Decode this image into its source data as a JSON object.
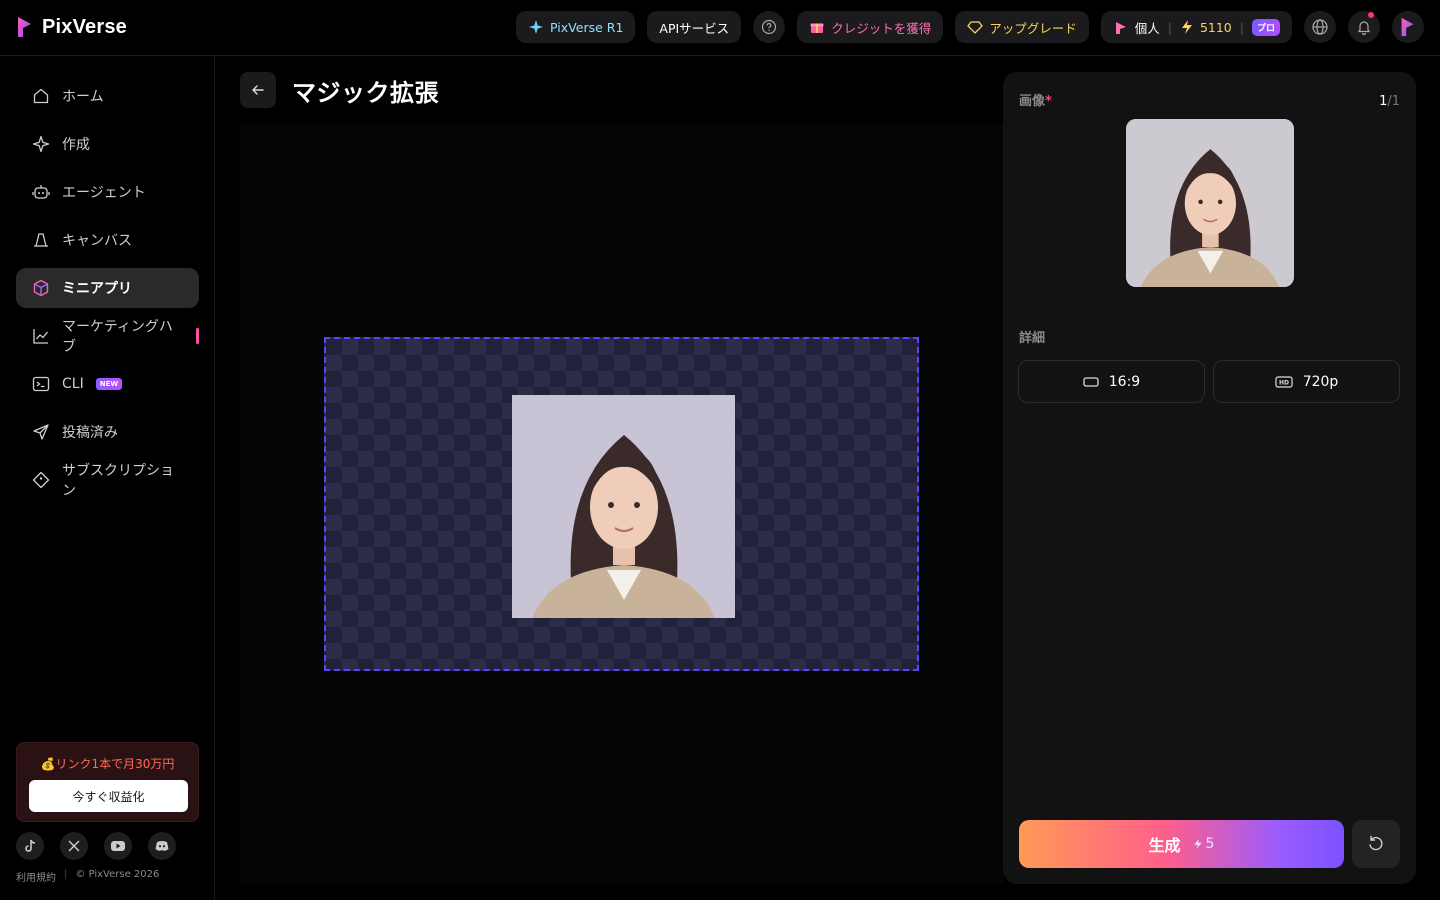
{
  "app": {
    "name": "PixVerse"
  },
  "topbar": {
    "r1_label": "PixVerse R1",
    "api_label": "APIサービス",
    "credits_label": "クレジットを獲得",
    "upgrade_label": "アップグレード",
    "account_label": "個人",
    "credit_count": "5110",
    "plan_label": "プロ"
  },
  "sidebar": {
    "items": [
      {
        "label": "ホーム",
        "icon": "home-icon"
      },
      {
        "label": "作成",
        "icon": "sparkle-icon"
      },
      {
        "label": "エージェント",
        "icon": "robot-icon"
      },
      {
        "label": "キャンバス",
        "icon": "canvas-icon"
      },
      {
        "label": "ミニアプリ",
        "icon": "cube-icon",
        "active": true
      },
      {
        "label": "マーケティングハブ",
        "icon": "chart-icon"
      },
      {
        "label": "CLI",
        "icon": "terminal-icon",
        "badge": "NEW"
      },
      {
        "label": "投稿済み",
        "icon": "send-icon"
      },
      {
        "label": "サブスクリプション",
        "icon": "diamond-icon"
      }
    ],
    "promo": {
      "text": "💰リンク1本で月30万円",
      "button": "今すぐ収益化"
    },
    "socials": [
      "tiktok-icon",
      "x-icon",
      "youtube-icon",
      "discord-icon"
    ],
    "footer": {
      "terms": "利用規約",
      "copyright": "© PixVerse 2026"
    }
  },
  "main": {
    "title": "マジック拡張"
  },
  "panel": {
    "image_label": "画像",
    "required_mark": "*",
    "counter_current": "1",
    "counter_total": "/1",
    "details_label": "詳細",
    "aspect_ratio": "16:9",
    "resolution": "720p",
    "generate_label": "生成",
    "generate_cost": "5"
  },
  "colors": {
    "accent": "#5b44ff",
    "brand_pink": "#ff4fa6",
    "gold": "#ffd35a"
  }
}
